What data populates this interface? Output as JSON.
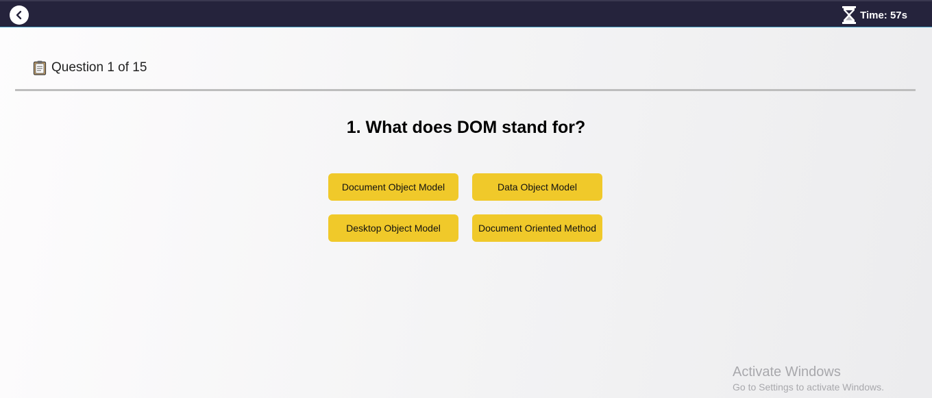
{
  "topbar": {
    "back_icon": "chevron-left-icon",
    "timer_icon": "hourglass-icon",
    "timer_text": "Time: 57s"
  },
  "question_header": {
    "icon": "clipboard-icon",
    "counter_text": "Question 1 of 15"
  },
  "question": {
    "title": "1. What does DOM stand for?",
    "options": [
      "Document Object Model",
      "Data Object Model",
      "Desktop Object Model",
      "Document Oriented Method"
    ]
  },
  "watermark": {
    "title": "Activate Windows",
    "subtitle": "Go to Settings to activate Windows."
  },
  "colors": {
    "topbar_bg": "#25233c",
    "option_bg": "#f0c92a",
    "divider": "#bdbdbd"
  }
}
